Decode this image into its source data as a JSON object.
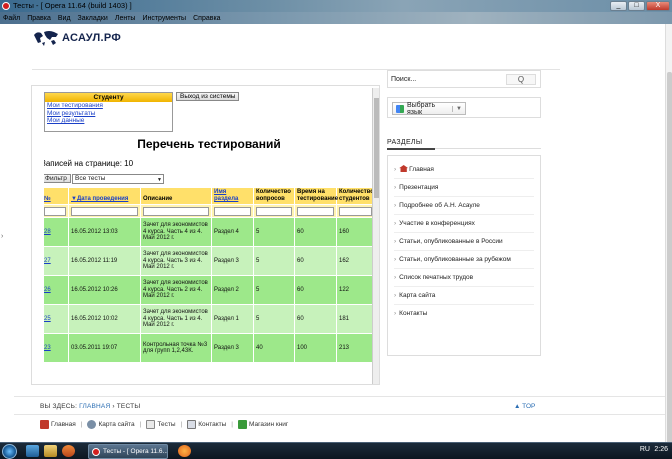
{
  "window": {
    "title": "Тесты - [ Opera 11.64 (build 1403) ]",
    "buttons": [
      "_",
      "□",
      "X"
    ]
  },
  "menu": [
    "Файл",
    "Правка",
    "Вид",
    "Закладки",
    "Ленты",
    "Инструменты",
    "Справка"
  ],
  "site": {
    "logo_text": "АСАУЛ.РФ"
  },
  "student_box": {
    "header": "Студенту",
    "links": [
      "Мои тестирования",
      "Мои результаты",
      "Мои данные"
    ],
    "logout": "Выход из системы"
  },
  "page_title": "Перечень тестирований",
  "records_per_page": "Записей на странице: 10",
  "filter": {
    "button": "Фильтр",
    "selected": "Все тесты"
  },
  "table": {
    "headers": [
      "№",
      "▼Дата проведения",
      "Описание",
      "Имя раздела",
      "Количество вопросов",
      "Время на тестирование",
      "Количество студентов"
    ],
    "rows": [
      {
        "num": "28",
        "date": "16.05.2012 13:03",
        "desc": "Зачет для экономистов 4 курса. Часть 4 из 4. Май 2012 г.",
        "section": "Раздел 4",
        "questions": "5",
        "time": "60",
        "students": "160"
      },
      {
        "num": "27",
        "date": "16.05.2012 11:19",
        "desc": "Зачет для экономистов 4 курса. Часть 3 из 4. Май 2012 г.",
        "section": "Раздел 3",
        "questions": "5",
        "time": "60",
        "students": "162"
      },
      {
        "num": "26",
        "date": "16.05.2012 10:26",
        "desc": "Зачет для экономистов 4 курса. Часть 2 из 4. Май 2012 г.",
        "section": "Раздел 2",
        "questions": "5",
        "time": "60",
        "students": "122"
      },
      {
        "num": "25",
        "date": "16.05.2012 10:02",
        "desc": "Зачет для экономистов 4 курса. Часть 1 из 4. Май 2012 г.",
        "section": "Раздел 1",
        "questions": "5",
        "time": "60",
        "students": "181"
      },
      {
        "num": "23",
        "date": "03.05.2011 19:07",
        "desc": "Контрольная точка №3 для групп 1,2,43К.",
        "section": "Раздел 3",
        "questions": "40",
        "time": "100",
        "students": "213"
      }
    ]
  },
  "sidebar": {
    "search_placeholder": "Поиск...",
    "search_button": "Q",
    "lang_button": "Выбрать язык",
    "lang_arrow": "▼",
    "section_title": "РАЗДЕЛЫ",
    "nav": [
      "Главная",
      "Презентация",
      "Подробнее об А.Н. Асауле",
      "Участие в конференциях",
      "Статьи, опубликованные в России",
      "Статьи, опубликованные за рубежом",
      "Список печатных трудов",
      "Карта сайта",
      "Контакты"
    ]
  },
  "breadcrumb": {
    "label": "ВЫ ЗДЕСЬ:",
    "home": "ГЛАВНАЯ",
    "sep": "›",
    "current": "ТЕСТЫ",
    "top": "▲ TOP"
  },
  "footer": {
    "items": [
      "Главная",
      "Карта сайта",
      "Тесты",
      "Контакты",
      "Магазин книг"
    ]
  },
  "taskbar": {
    "task1": "Тесты - [ Opera 11.6...",
    "lang": "RU",
    "time": "2:26"
  }
}
